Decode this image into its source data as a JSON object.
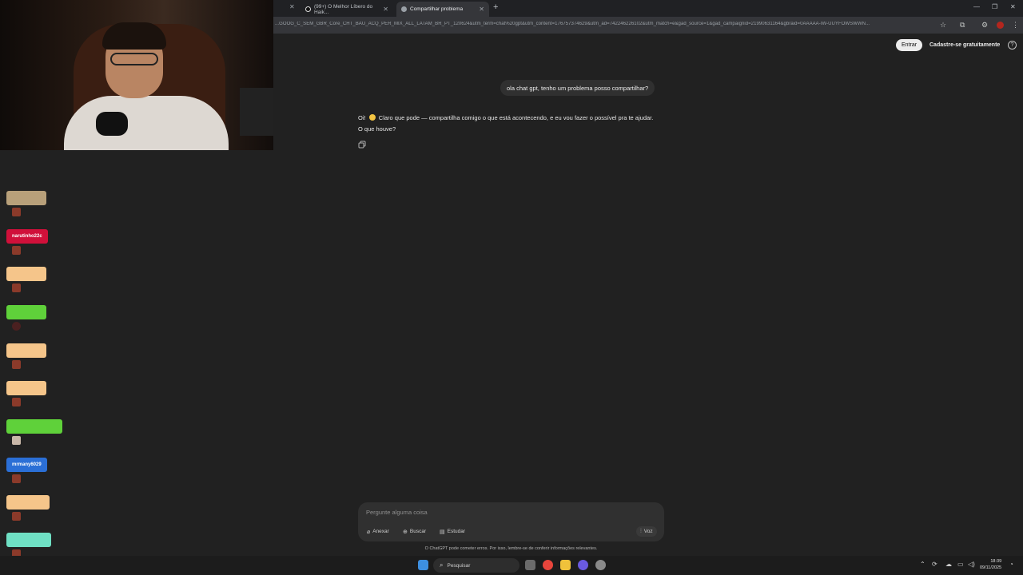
{
  "browser": {
    "tabs": [
      {
        "label": "(99+) O Melhor Líbero do Haik...",
        "active": false
      },
      {
        "label": "Compartilhar problema",
        "active": true
      }
    ],
    "url": "...GOOG_C_SEM_GBR_Core_CHT_BAU_ACQ_PER_MIX_ALL_LATAM_BR_PT_120624&utm_term=chat%20gpt&utm_content=176757374629&utm_ad=742246226102&utm_match=e&gad_source=1&gad_campaignid=21990631164&gbraid=0AAAAA-IW-UUYFOWSWWN...",
    "icons": [
      "star-icon",
      "extensions-icon",
      "puzzle-icon",
      "profile-icon",
      "kebab-icon"
    ]
  },
  "header": {
    "login_label": "Entrar",
    "signup_label": "Cadastre-se gratuitamente"
  },
  "conversation": {
    "user_message": "ola chat gpt, tenho um problema posso compartilhar?",
    "assistant_before_emoji": "Oi!",
    "assistant_after_emoji": "Claro que pode — compartilha comigo o que está acontecendo, e eu vou fazer o possível pra te ajudar. O que houve?"
  },
  "composer": {
    "placeholder": "Pergunte alguma coisa",
    "attach_label": "Anexar",
    "search_label": "Buscar",
    "study_label": "Estudar",
    "voice_label": "Voz",
    "disclaimer": "O ChatGPT pode cometer erros. Por isso, lembre-se de conferir informações relevantes."
  },
  "stream_chat": {
    "messages": [
      {
        "name": "",
        "color": "#b8a07a"
      },
      {
        "name": "narutinho22c",
        "color": "#d0103a"
      },
      {
        "name": "",
        "color": "#f5c58a"
      },
      {
        "name": "",
        "color": "#5fd13a"
      },
      {
        "name": "",
        "color": "#f5c58a"
      },
      {
        "name": "",
        "color": "#f5c58a"
      },
      {
        "name": "",
        "color": "#5fd13a"
      },
      {
        "name": "mrmany6029",
        "color": "#2b6fd6"
      },
      {
        "name": "",
        "color": "#f5c58a"
      },
      {
        "name": "",
        "color": "#6fe0c4"
      }
    ]
  },
  "taskbar": {
    "search_label": "Pesquisar",
    "time": "18:39",
    "date": "09/11/2025"
  }
}
